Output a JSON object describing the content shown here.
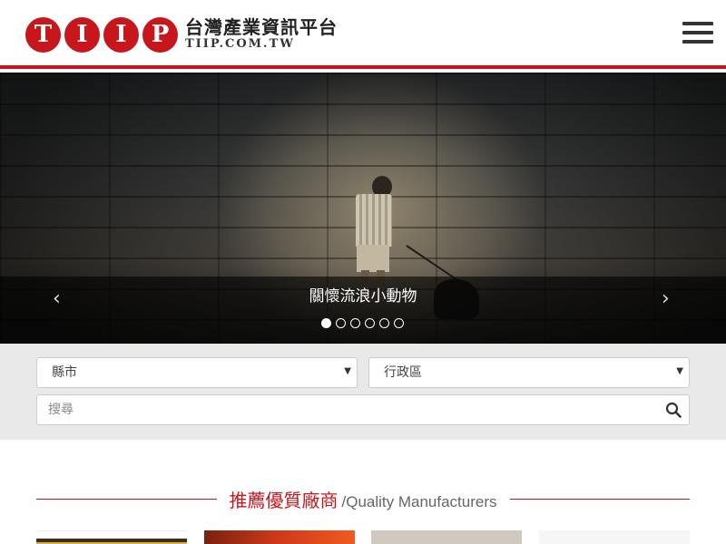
{
  "header": {
    "logo_letters": [
      "T",
      "I",
      "I",
      "P"
    ],
    "logo_title": "台灣產業資訊平台",
    "logo_subtitle": "TIIP.COM.TW",
    "menu_icon": "hamburger-menu-icon"
  },
  "hero": {
    "caption": "關懷流浪小動物",
    "prev_arrow": "‹",
    "next_arrow": "›",
    "slide_count": 6,
    "active_slide": 1
  },
  "search": {
    "county_label": "縣市",
    "district_label": "行政區",
    "placeholder": "搜尋",
    "search_icon": "search-icon",
    "caret": "▼"
  },
  "section": {
    "title_zh": "推薦優質廠商",
    "title_en": "/Quality Manufacturers"
  },
  "colors": {
    "brand_red": "#c8161d",
    "search_bg": "#e9e9e9"
  }
}
